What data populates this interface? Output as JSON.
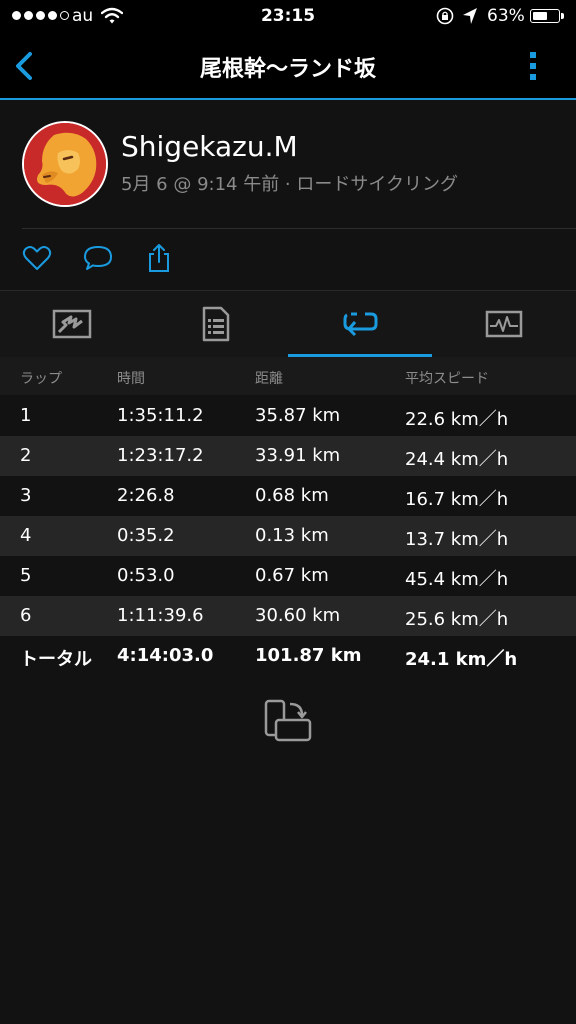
{
  "status_bar": {
    "carrier": "au",
    "time": "23:15",
    "battery_percent": "63%",
    "battery_level": 0.63,
    "signal_bars_filled": 4,
    "signal_bars_total": 5
  },
  "nav": {
    "title": "尾根幹〜ランド坂",
    "back_icon": "chevron-left-icon",
    "more_icon": "more-vertical-icon",
    "accent_color": "#1a9be0"
  },
  "activity": {
    "user_name": "Shigekazu.M",
    "meta": "5月 6 @ 9:14 午前 · ロードサイクリング"
  },
  "actions": [
    {
      "icon": "heart-icon"
    },
    {
      "icon": "comment-icon"
    },
    {
      "icon": "share-icon"
    }
  ],
  "tabs": [
    {
      "icon": "map-icon",
      "active": false
    },
    {
      "icon": "details-icon",
      "active": false
    },
    {
      "icon": "laps-icon",
      "active": true
    },
    {
      "icon": "chart-icon",
      "active": false
    }
  ],
  "laps_table": {
    "headers": [
      "ラップ",
      "時間",
      "距離",
      "平均スピード"
    ],
    "rows": [
      [
        "1",
        "1:35:11.2",
        "35.87 km",
        "22.6 km／h"
      ],
      [
        "2",
        "1:23:17.2",
        "33.91 km",
        "24.4 km／h"
      ],
      [
        "3",
        "2:26.8",
        "0.68 km",
        "16.7 km／h"
      ],
      [
        "4",
        "0:35.2",
        "0.13 km",
        "13.7 km／h"
      ],
      [
        "5",
        "0:53.0",
        "0.67 km",
        "45.4 km／h"
      ],
      [
        "6",
        "1:11:39.6",
        "30.60 km",
        "25.6 km／h"
      ]
    ],
    "total": [
      "トータル",
      "4:14:03.0",
      "101.87 km",
      "24.1 km／h"
    ]
  },
  "rotate_icon": "rotate-device-icon"
}
